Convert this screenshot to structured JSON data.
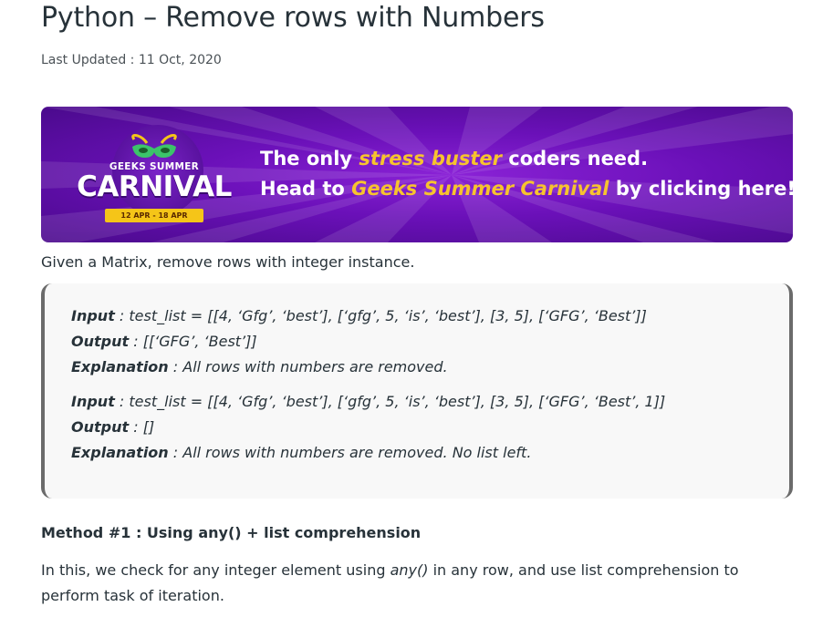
{
  "article": {
    "title": "Python – Remove rows with Numbers",
    "last_updated": "Last Updated : 11 Oct, 2020"
  },
  "banner": {
    "logo_sub": "GEEKS SUMMER",
    "logo_main": "CARNIVAL",
    "logo_dates": "12 APR - 18 APR",
    "line1_pre": "The only ",
    "line1_highlight": "stress buster",
    "line1_post": " coders need.",
    "line2_pre": "Head to ",
    "line2_highlight": "Geeks Summer Carnival",
    "line2_post": " by clicking here!",
    "colors": {
      "background": "#6a10b8",
      "highlight": "#f7c32e",
      "text": "#ffffff"
    }
  },
  "intro": "Given a Matrix, remove rows with integer instance.",
  "examples": [
    {
      "input_label": "Input",
      "input_value": " : test_list = [[4, ‘Gfg’, ‘best’], [‘gfg’, 5, ‘is’, ‘best’], [3, 5], [‘GFG’, ‘Best’]]",
      "output_label": "Output",
      "output_value": " : [[‘GFG’, ‘Best’]]",
      "explanation_label": "Explanation",
      "explanation_value": " : All rows with numbers are removed."
    },
    {
      "input_label": "Input",
      "input_value": " : test_list = [[4, ‘Gfg’, ‘best’], [‘gfg’, 5, ‘is’, ‘best’], [3, 5], [‘GFG’, ‘Best’, 1]]",
      "output_label": "Output",
      "output_value": " : []",
      "explanation_label": "Explanation",
      "explanation_value": " : All rows with numbers are removed. No list left."
    }
  ],
  "method": {
    "heading": "Method #1 : Using any() + list comprehension",
    "para_pre": "In this, we check for any integer element using ",
    "para_code": "any()",
    "para_post": " in any row, and use list comprehension to perform task of iteration."
  }
}
